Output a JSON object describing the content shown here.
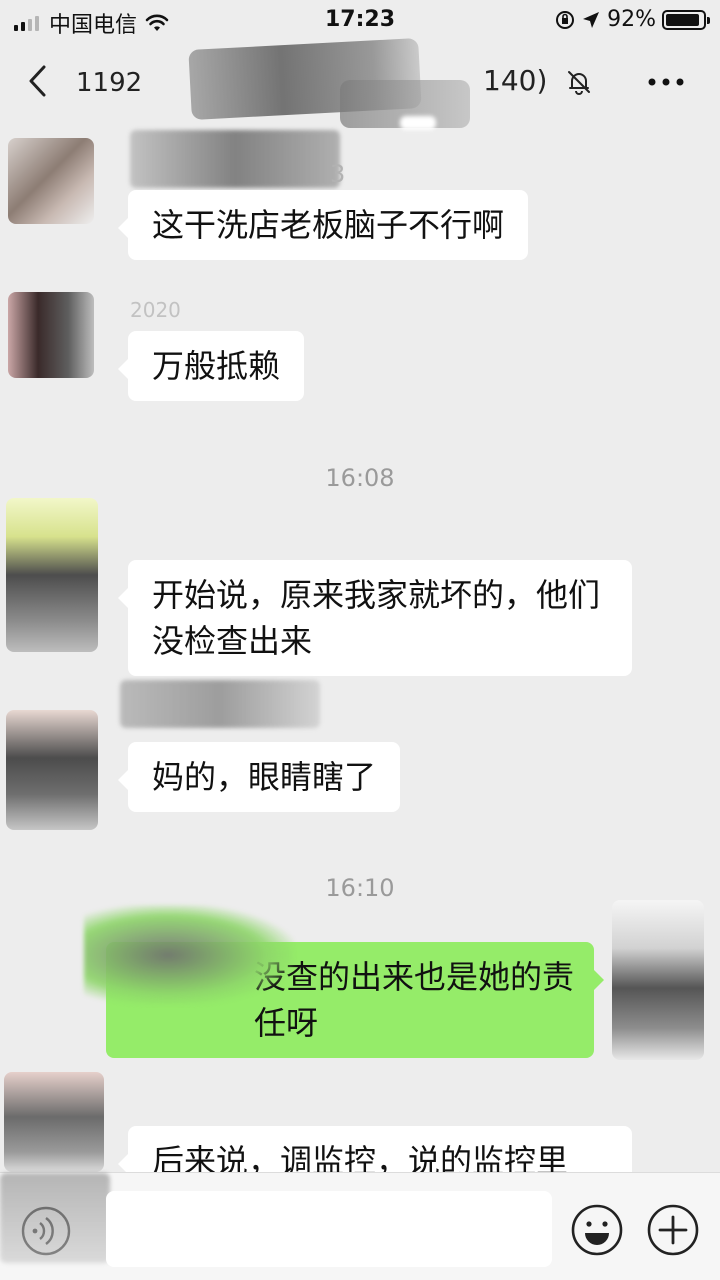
{
  "status_bar": {
    "carrier": "中国电信",
    "time": "17:23",
    "battery": "92%",
    "battery_level": 0.92
  },
  "nav": {
    "title": "1192",
    "member_count": "140)"
  },
  "messages": [
    {
      "type": "text",
      "side": "left",
      "text": "这干洗店老板脑子不行啊"
    },
    {
      "type": "text",
      "side": "left",
      "text": "万般抵赖"
    },
    {
      "type": "time",
      "text": "16:08"
    },
    {
      "type": "text",
      "side": "left",
      "text": "开始说，原来我家就坏的，他们没检查出来"
    },
    {
      "type": "text",
      "side": "left",
      "text": "妈的，眼睛瞎了"
    },
    {
      "type": "time",
      "text": "16:10"
    },
    {
      "type": "text",
      "side": "right",
      "text": "没查的出来也是她的责任呀"
    },
    {
      "type": "text",
      "side": "left",
      "text": "后来说，调监控，说的监控里"
    }
  ],
  "sender_name_fragments": [
    "3",
    "2020"
  ],
  "input": {
    "placeholder": ""
  },
  "icons": {
    "back": "chevron-left-icon",
    "mute": "bell-off-icon",
    "more": "more-dots-icon",
    "voice": "voice-icon",
    "emoji": "emoji-icon",
    "plus": "plus-icon"
  },
  "colors": {
    "background": "#ededed",
    "bubble_self": "#95ec69",
    "bubble_other": "#ffffff",
    "timestamp": "#9a9a9a"
  }
}
